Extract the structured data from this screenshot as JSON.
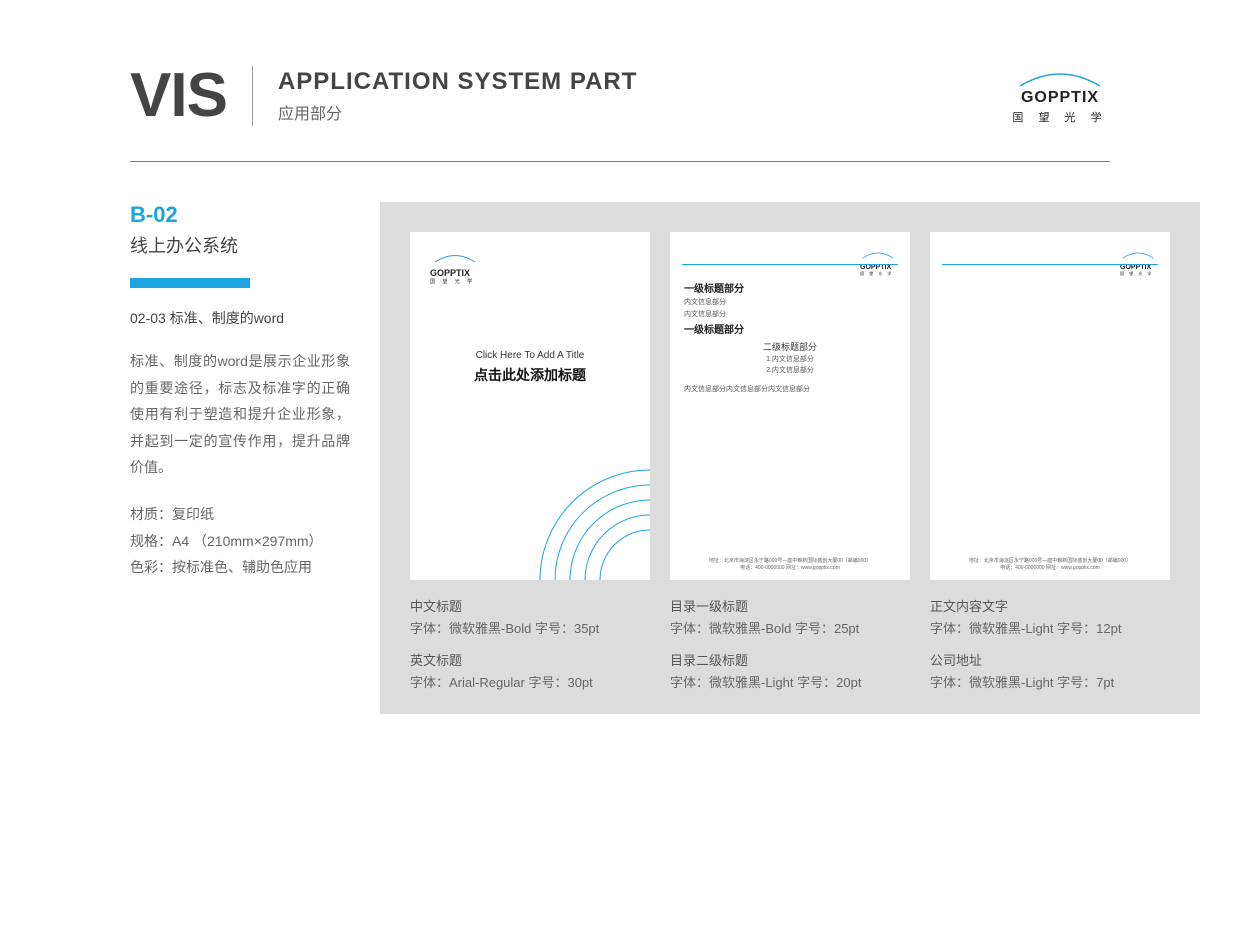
{
  "header": {
    "vis": "VIS",
    "title": "APPLICATION SYSTEM PART",
    "subtitle": "应用部分"
  },
  "logo": {
    "name": "GOPPTIX",
    "cn": "国 望 光 学"
  },
  "left": {
    "code": "B-02",
    "codeTitle": "线上办公系统",
    "subCode": "02-03  标准、制度的word",
    "para": "标准、制度的word是展示企业形象的重要途径，标志及标准字的正确使用有利于塑造和提升企业形象，并起到一定的宣传作用，提升品牌价值。",
    "spec1": "材质：复印纸",
    "spec2": "规格：A4 （210mm×297mm）",
    "spec3": "色彩：按标准色、辅助色应用"
  },
  "doc1": {
    "titleEn": "Click Here To Add A Title",
    "titleCn": "点击此处添加标题"
  },
  "doc2": {
    "h1a": "一级标题部分",
    "p1": "内文信息部分",
    "p2": "内文信息部分",
    "h1b": "一级标题部分",
    "h2": "二级标题部分",
    "list1": "1.内文信息部分",
    "list2": "2.内文信息部分",
    "footer": "内文信息部分内文信息部分内文信息部分"
  },
  "docFooter": {
    "line1": "地址：北京市海淀区永宁路000号—座中粮新国际盛创大厦00（邮编000）",
    "line2": "电话：400-0000000      网址：www.gopptix.com"
  },
  "captions": {
    "c1t1": "中文标题",
    "c1l1": "字体：微软雅黑-Bold    字号：35pt",
    "c1t2": "英文标题",
    "c1l2": "字体：Arial-Regular    字号：30pt",
    "c2t1": "目录一级标题",
    "c2l1": "字体：微软雅黑-Bold    字号：25pt",
    "c2t2": "目录二级标题",
    "c2l2": "字体：微软雅黑-Light   字号：20pt",
    "c3t1": "正文内容文字",
    "c3l1": "字体：微软雅黑-Light   字号：12pt",
    "c3t2": "公司地址",
    "c3l2": "字体：微软雅黑-Light     字号：7pt"
  }
}
